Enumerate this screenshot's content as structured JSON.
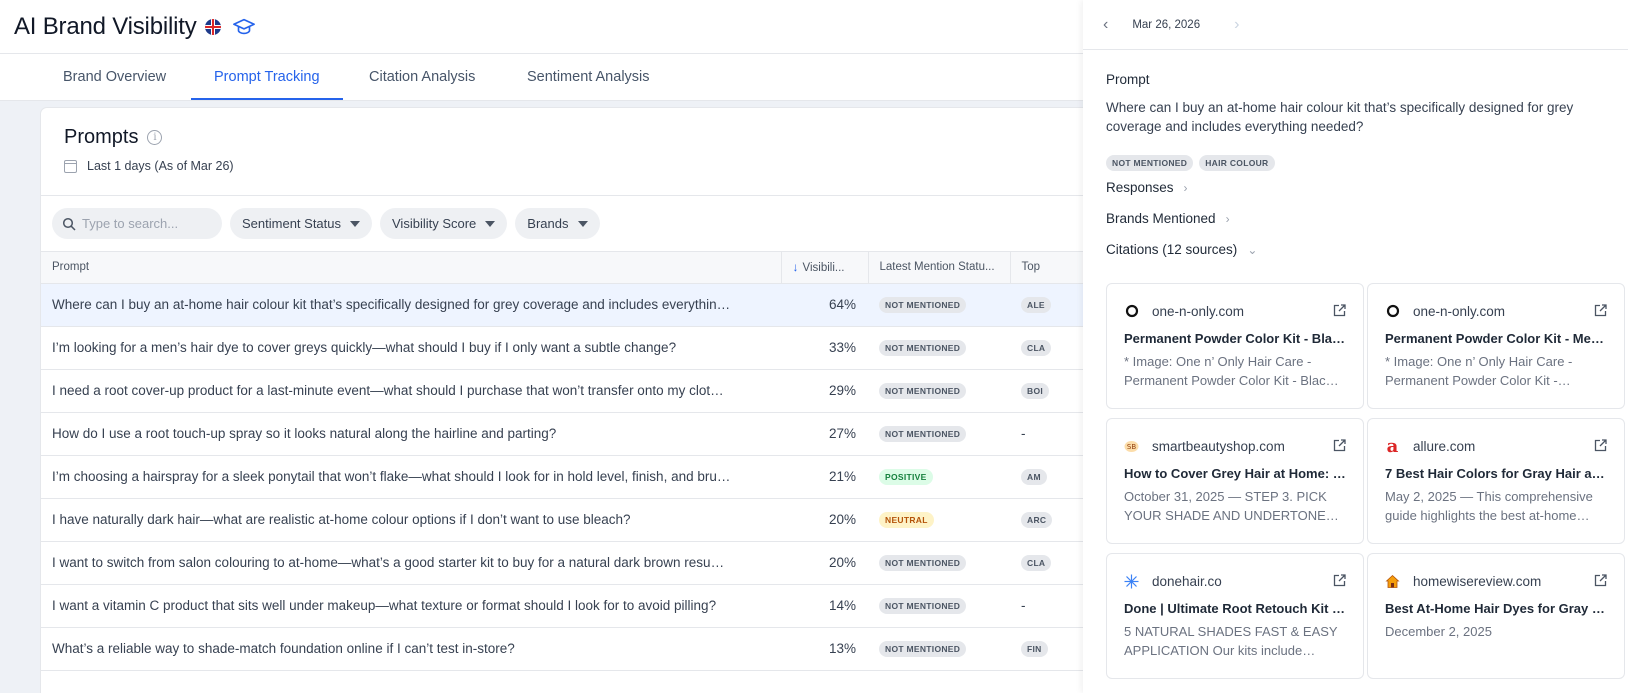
{
  "header": {
    "title": "AI Brand Visibility",
    "region_icon": "uk-flag-icon",
    "help_icon": "graduation-cap-icon"
  },
  "tabs": [
    {
      "label": "Brand Overview",
      "active": false
    },
    {
      "label": "Prompt Tracking",
      "active": true
    },
    {
      "label": "Citation Analysis",
      "active": false
    },
    {
      "label": "Sentiment Analysis",
      "active": false
    }
  ],
  "prompts_card": {
    "title": "Prompts",
    "date_range": "Last 1 days (As of Mar 26)",
    "search_placeholder": "Type to search...",
    "filters": [
      "Sentiment Status",
      "Visibility Score",
      "Brands"
    ],
    "columns": [
      "Prompt",
      "Visibili...",
      "Latest Mention Statu...",
      "Top"
    ],
    "rows": [
      {
        "prompt": "Where can I buy an at-home hair colour kit that’s specifically designed for grey coverage and includes everythin…",
        "visibility": "64%",
        "status": "NOT MENTIONED",
        "top": "ALE",
        "selected": true
      },
      {
        "prompt": "I’m looking for a men’s hair dye to cover greys quickly—what should I buy if I only want a subtle change?",
        "visibility": "33%",
        "status": "NOT MENTIONED",
        "top": "CLA"
      },
      {
        "prompt": "I need a root cover-up product for a last-minute event—what should I purchase that won’t transfer onto my clot…",
        "visibility": "29%",
        "status": "NOT MENTIONED",
        "top": "BOI"
      },
      {
        "prompt": "How do I use a root touch-up spray so it looks natural along the hairline and parting?",
        "visibility": "27%",
        "status": "NOT MENTIONED",
        "top": "-"
      },
      {
        "prompt": "I’m choosing a hairspray for a sleek ponytail that won’t flake—what should I look for in hold level, finish, and bru…",
        "visibility": "21%",
        "status": "POSITIVE",
        "top": "AM"
      },
      {
        "prompt": "I have naturally dark hair—what are realistic at-home colour options if I don’t want to use bleach?",
        "visibility": "20%",
        "status": "NEUTRAL",
        "top": "ARC"
      },
      {
        "prompt": "I want to switch from salon colouring to at-home—what’s a good starter kit to buy for a natural dark brown resu…",
        "visibility": "20%",
        "status": "NOT MENTIONED",
        "top": "CLA"
      },
      {
        "prompt": "I want a vitamin C product that sits well under makeup—what texture or format should I look for to avoid pilling?",
        "visibility": "14%",
        "status": "NOT MENTIONED",
        "top": "-"
      },
      {
        "prompt": "What’s a reliable way to shade-match foundation online if I can’t test in-store?",
        "visibility": "13%",
        "status": "NOT MENTIONED",
        "top": "FIN"
      }
    ]
  },
  "drawer": {
    "date": "Mar 26, 2026",
    "prompt_label": "Prompt",
    "prompt_text": "Where can I buy an at-home hair colour kit that’s specifically designed for grey coverage and includes everything needed?",
    "badges": [
      "NOT MENTIONED",
      "HAIR COLOUR"
    ],
    "responses_label": "Responses",
    "brands_label": "Brands Mentioned",
    "citations_label": "Citations (12 sources)",
    "citations": [
      {
        "domain": "one-n-only.com",
        "favicon": "ring-icon",
        "title": "Permanent Powder Color Kit - Bla…",
        "snippet": "* Image: One n’ Only Hair Care - Permanent Powder Color Kit - Blac…"
      },
      {
        "domain": "one-n-only.com",
        "favicon": "ring-icon",
        "title": "Permanent Powder Color Kit - Me…",
        "snippet": "* Image: One n’ Only Hair Care - Permanent Powder Color Kit -…"
      },
      {
        "domain": "smartbeautyshop.com",
        "favicon": "shop-icon",
        "title": "How to Cover Grey Hair at Home: …",
        "snippet": "October 31, 2025 — STEP 3. PICK YOUR SHADE AND UNDERTONE…"
      },
      {
        "domain": "allure.com",
        "favicon": "allure-a-icon",
        "title": "7 Best Hair Colors for Gray Hair at…",
        "snippet": "May 2, 2025 — This comprehensive guide highlights the best at-home…"
      },
      {
        "domain": "donehair.co",
        "favicon": "sparkle-icon",
        "title": "Done | Ultimate Root Retouch Kit |…",
        "snippet": "5 NATURAL SHADES FAST & EASY APPLICATION Our kits include…"
      },
      {
        "domain": "homewisereview.com",
        "favicon": "house-icon",
        "title": "Best At-Home Hair Dyes for Gray …",
        "snippet": "December 2, 2025"
      }
    ]
  },
  "colors": {
    "accent": "#2563eb",
    "positive": "#15803d",
    "neutral": "#b45309",
    "allure_red": "#dc2626"
  }
}
